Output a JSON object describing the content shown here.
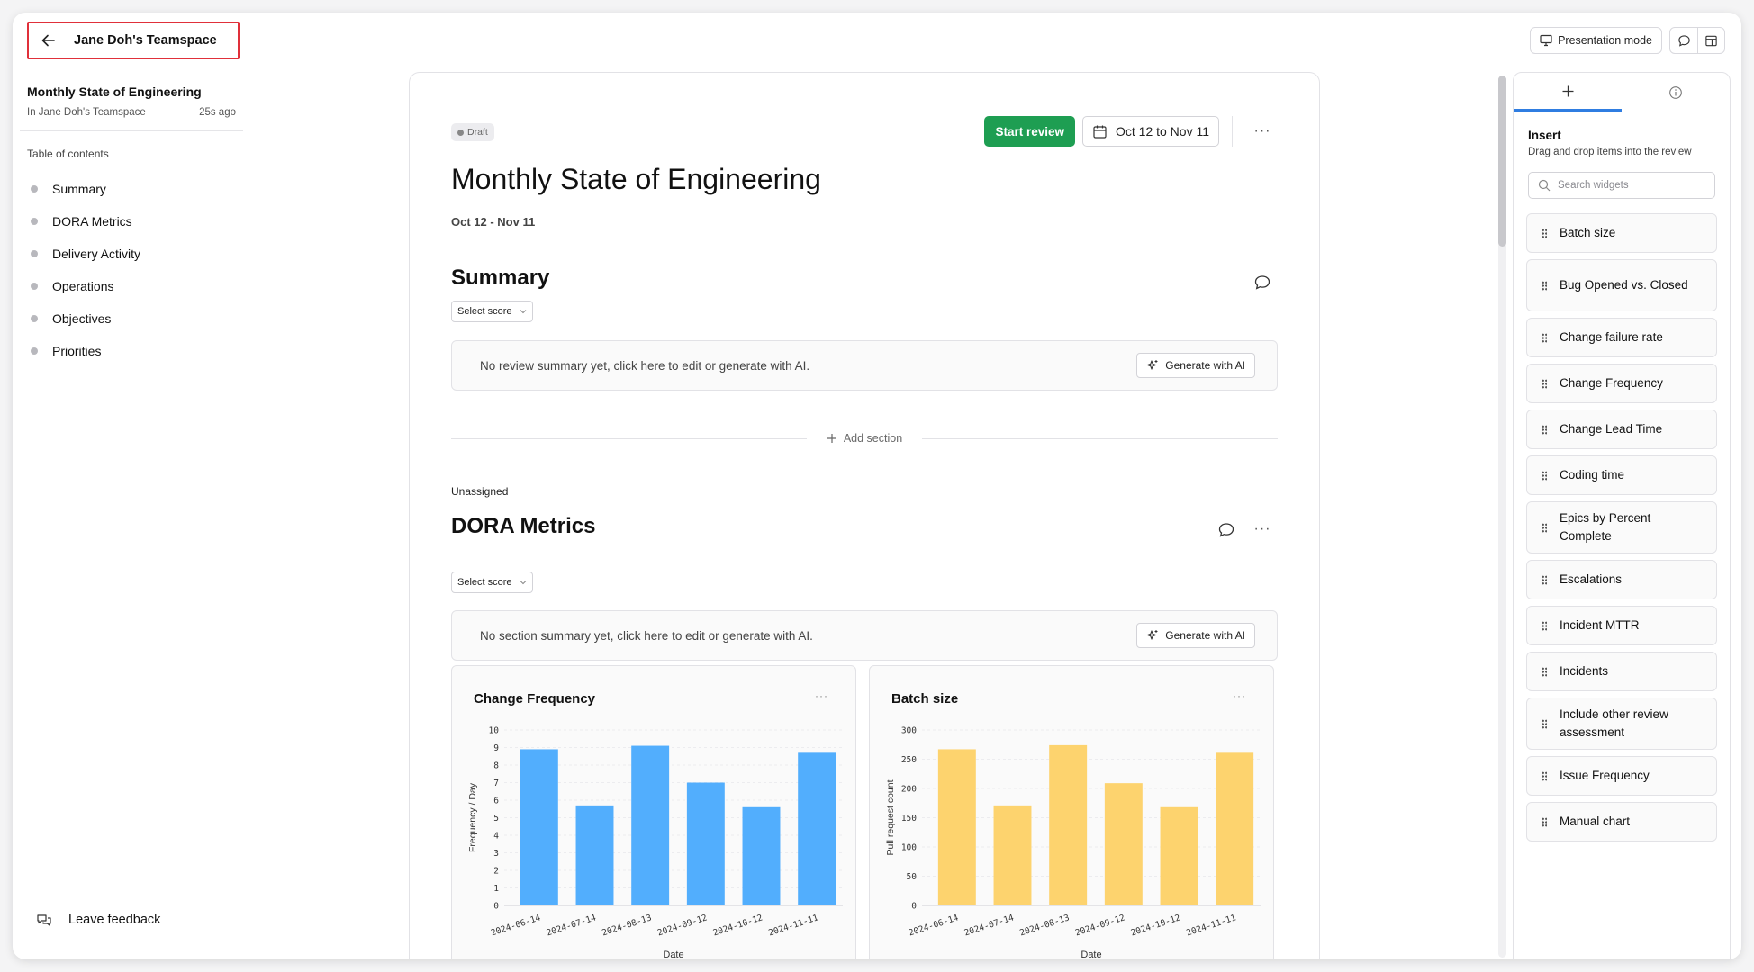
{
  "top": {
    "back_label": "Jane Doh's Teamspace",
    "presentation_label": "Presentation mode"
  },
  "sidebar": {
    "doc_title": "Monthly State of Engineering",
    "location": "In Jane Doh's Teamspace",
    "updated": "25s ago",
    "toc_heading": "Table of contents",
    "toc": [
      "Summary",
      "DORA Metrics",
      "Delivery Activity",
      "Operations",
      "Objectives",
      "Priorities"
    ],
    "feedback_label": "Leave feedback"
  },
  "doc": {
    "status": "Draft",
    "start_review": "Start review",
    "date_range_button": "Oct 12 to Nov 11",
    "title": "Monthly State of Engineering",
    "date_range": "Oct 12 - Nov 11",
    "summary": {
      "heading": "Summary",
      "select_score": "Select score",
      "placeholder": "No review summary yet, click here to edit or generate with AI.",
      "generate": "Generate with AI"
    },
    "add_section": "Add section",
    "dora": {
      "owner": "Unassigned",
      "heading": "DORA Metrics",
      "select_score": "Select score",
      "placeholder": "No section summary yet, click here to edit or generate with AI.",
      "generate": "Generate with AI"
    }
  },
  "chart_data": [
    {
      "type": "bar",
      "title": "Change Frequency",
      "xlabel": "Date",
      "ylabel": "Frequency / Day",
      "categories": [
        "2024-06-14",
        "2024-07-14",
        "2024-08-13",
        "2024-09-12",
        "2024-10-12",
        "2024-11-11"
      ],
      "values": [
        8.9,
        5.7,
        9.1,
        7.0,
        5.6,
        8.7
      ],
      "ylim": [
        0,
        10
      ],
      "yticks": [
        0,
        1,
        2,
        3,
        4,
        5,
        6,
        7,
        8,
        9,
        10
      ],
      "color": "#52aefd"
    },
    {
      "type": "bar",
      "title": "Batch size",
      "xlabel": "Date",
      "ylabel": "Pull request count",
      "categories": [
        "2024-06-14",
        "2024-07-14",
        "2024-08-13",
        "2024-09-12",
        "2024-10-12",
        "2024-11-11"
      ],
      "values": [
        267,
        171,
        274,
        209,
        168,
        261
      ],
      "ylim": [
        0,
        300
      ],
      "yticks": [
        0,
        50,
        100,
        150,
        200,
        250,
        300
      ],
      "color": "#fdd36e"
    }
  ],
  "panel": {
    "insert_heading": "Insert",
    "insert_sub": "Drag and drop items into the review",
    "search_placeholder": "Search widgets",
    "widgets": [
      "Batch size",
      "Bug Opened vs. Closed",
      "Change failure rate",
      "Change Frequency",
      "Change Lead Time",
      "Coding time",
      "Epics by Percent Complete",
      "Escalations",
      "Incident MTTR",
      "Incidents",
      "Include other review assessment",
      "Issue Frequency",
      "Manual chart"
    ]
  }
}
